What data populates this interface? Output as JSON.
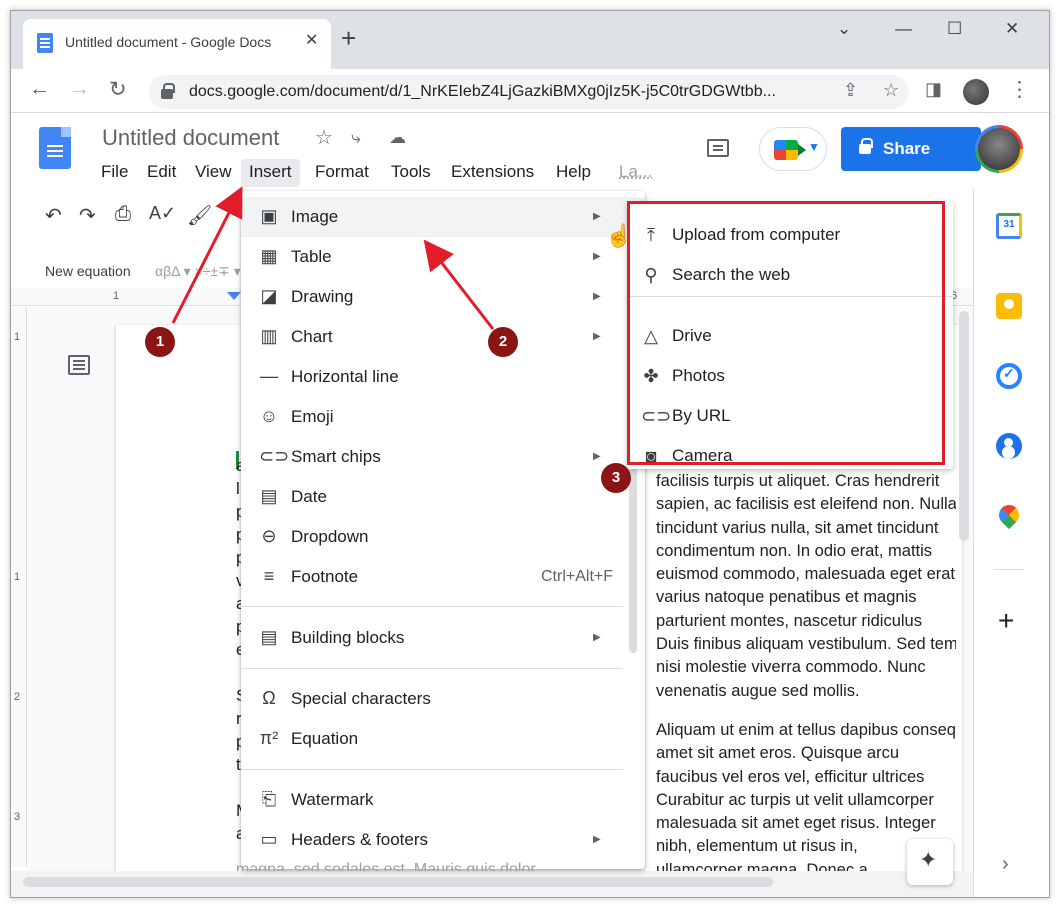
{
  "browser": {
    "tab_title": "Untitled document - Google Docs",
    "tab_close": "✕",
    "new_tab": "+",
    "url": "docs.google.com/document/d/1_NrKEIebZ4LjGazkiBMXg0jIz5K-j5C0trGDGWtbb...",
    "window_controls": [
      "⌄",
      "—",
      "☐",
      "✕"
    ]
  },
  "docs": {
    "title": "Untitled document",
    "menus": [
      "File",
      "Edit",
      "View",
      "Insert",
      "Format",
      "Tools",
      "Extensions",
      "Help",
      "La..."
    ],
    "active_menu": "Insert",
    "share_label": "Share",
    "equation_label": "New equation",
    "equation_symbols": "αβΔ ▾  ×÷±∓ ▾"
  },
  "ruler": {
    "h_labels": [
      "1",
      "6"
    ],
    "v_labels": [
      "1",
      "1",
      "2",
      "3"
    ]
  },
  "insert_menu": {
    "items": [
      {
        "label": "Image",
        "icon": "image-icon",
        "submenu": true
      },
      {
        "label": "Table",
        "icon": "table-icon",
        "submenu": true
      },
      {
        "label": "Drawing",
        "icon": "drawing-icon",
        "submenu": true
      },
      {
        "label": "Chart",
        "icon": "chart-icon",
        "submenu": true
      },
      {
        "label": "Horizontal line",
        "icon": "horizontal-line-icon",
        "submenu": false
      },
      {
        "label": "Emoji",
        "icon": "emoji-icon",
        "submenu": false
      },
      {
        "label": "Smart chips",
        "icon": "smart-chips-icon",
        "submenu": true
      },
      {
        "label": "Date",
        "icon": "date-icon",
        "submenu": false
      },
      {
        "label": "Dropdown",
        "icon": "dropdown-icon",
        "submenu": false
      },
      {
        "label": "Footnote",
        "icon": "footnote-icon",
        "submenu": false,
        "shortcut": "Ctrl+Alt+F"
      },
      {
        "label": "Building blocks",
        "icon": "building-blocks-icon",
        "submenu": true
      },
      {
        "label": "Special characters",
        "icon": "omega-icon",
        "submenu": false
      },
      {
        "label": "Equation",
        "icon": "pi-icon",
        "submenu": false
      },
      {
        "label": "Watermark",
        "icon": "watermark-icon",
        "submenu": false
      },
      {
        "label": "Headers & footers",
        "icon": "headers-footers-icon",
        "submenu": true
      }
    ]
  },
  "image_submenu": {
    "items": [
      {
        "label": "Upload from computer",
        "icon": "upload-icon"
      },
      {
        "label": "Search the web",
        "icon": "search-icon"
      },
      {
        "label": "Drive",
        "icon": "drive-icon"
      },
      {
        "label": "Photos",
        "icon": "photos-icon"
      },
      {
        "label": "By URL",
        "icon": "link-icon"
      },
      {
        "label": "Camera",
        "icon": "camera-icon"
      }
    ]
  },
  "document_text": {
    "left_column_letters": [
      "a",
      "l",
      "p",
      "p",
      "p",
      "v",
      "a",
      "p",
      "e",
      "",
      "S",
      "r",
      "p",
      "t",
      "",
      "M",
      "a"
    ],
    "paragraph1": [
      "facilisis turpis ut aliquet. Cras hendrerit",
      "sapien, ac facilisis est eleifend non. Nullam",
      "tincidunt varius nulla, sit amet tincidunt",
      "condimentum non. In odio erat, mattis",
      "euismod commodo, malesuada eget erat.",
      "varius natoque penatibus et magnis",
      "parturient montes, nascetur ridiculus",
      "Duis finibus aliquam vestibulum. Sed tempor",
      "nisi molestie viverra commodo. Nunc",
      "venenatis augue sed mollis."
    ],
    "paragraph2": [
      "Aliquam ut enim at tellus dapibus consequat",
      "amet sit amet eros. Quisque arcu",
      "faucibus vel eros vel, efficitur ultrices",
      "Curabitur ac turpis ut velit ullamcorper",
      "malesuada sit amet eget risus. Integer",
      "nibh, elementum ut risus in,",
      "ullamcorper magna. Donec a"
    ],
    "bottom_fragment": "magna, sed sodales est. Mauris quis dolor"
  },
  "annotations": {
    "badges": [
      "1",
      "2",
      "3"
    ],
    "arrow_color": "#e11d2a",
    "badge_color": "#8b1515"
  },
  "side_panel": {
    "calendar_label": "31"
  },
  "colors": {
    "accent": "#1a73e8",
    "highlight": "#e11d2a"
  }
}
